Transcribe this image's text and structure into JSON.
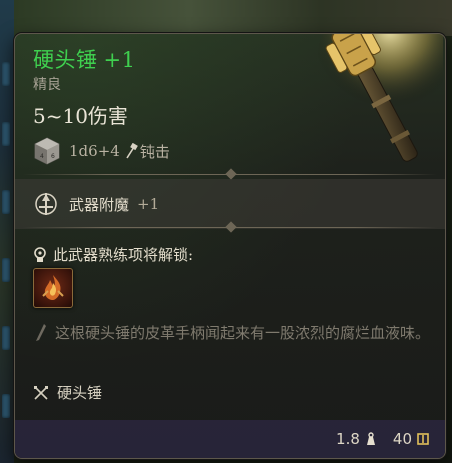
{
  "item": {
    "name": "硬头锤",
    "enchant_suffix": "+1",
    "rarity": "精良",
    "damage": "5~10伤害",
    "dice_formula": "1d6+4",
    "damage_type": "钝击",
    "weapon_icon": "mace-icon"
  },
  "enchantment": {
    "label": "武器附魔",
    "value": "+1"
  },
  "mastery": {
    "title": "此武器熟练项将解锁:",
    "skill_icon": "fire-skill-icon"
  },
  "flavor_text": "这根硬头锤的皮革手柄闻起来有一股浓烈的腐烂血液味。",
  "weapon_type": "硬头锤",
  "footer": {
    "weight": "1.8",
    "price": "40"
  },
  "colors": {
    "item_name": "#3fcf4f",
    "rarity": "#a7a294",
    "footer_bg": "#2a263e"
  }
}
